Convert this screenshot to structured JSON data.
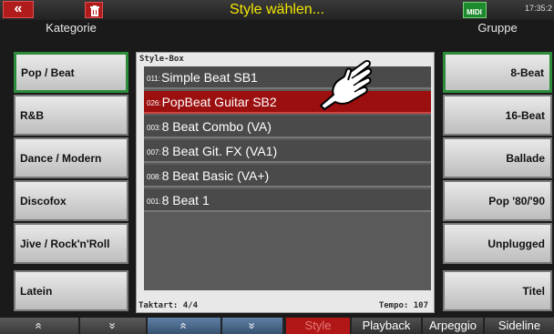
{
  "header": {
    "back_glyph": "«",
    "title": "Style wählen...",
    "clock": "17:35:2",
    "mem_label": "MIDI"
  },
  "columns": {
    "left_title": "Kategorie",
    "right_title": "Gruppe"
  },
  "categories": [
    {
      "label": "Pop / Beat",
      "active": true
    },
    {
      "label": "R&B"
    },
    {
      "label": "Dance / Modern"
    },
    {
      "label": "Discofox"
    },
    {
      "label": "Jive / Rock'n'Roll"
    },
    {
      "label": "Latein"
    }
  ],
  "groups": [
    {
      "label": "8-Beat",
      "active": true
    },
    {
      "label": "16-Beat"
    },
    {
      "label": "Ballade"
    },
    {
      "label": "Pop '80/'90"
    },
    {
      "label": "Unplugged"
    },
    {
      "label": "Titel"
    }
  ],
  "stylebox": {
    "title": "Style-Box",
    "items": [
      {
        "num": "011:",
        "name": "Simple Beat SB1"
      },
      {
        "num": "026:",
        "name": "PopBeat Guitar SB2",
        "selected": true
      },
      {
        "num": "003:",
        "name": "8 Beat Combo (VA)"
      },
      {
        "num": "007:",
        "name": "8 Beat Git. FX (VA1)"
      },
      {
        "num": "008:",
        "name": "8 Beat Basic (VA+)"
      },
      {
        "num": "001:",
        "name": "8 Beat 1"
      }
    ],
    "taktart": "Taktart: 4/4",
    "tempo": "Tempo: 107"
  },
  "bottom_bar": {
    "up1": "«",
    "down1": "»",
    "up2": "«",
    "down2": "»",
    "style": "Style",
    "playback": "Playback",
    "arpeggio": "Arpeggio",
    "sideline": "Sideline"
  },
  "colors": {
    "title": "#f2e600",
    "selected_row": "#9c0f0f",
    "active_border": "#2c8c3c"
  }
}
